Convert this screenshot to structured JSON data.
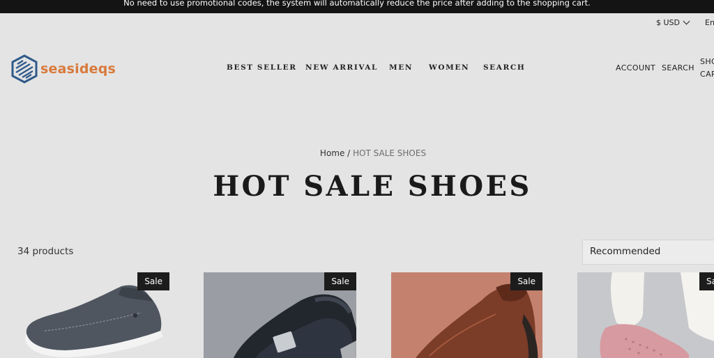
{
  "announcement": "No need to use promotional codes, the system will automatically reduce the price after adding to the shopping cart.",
  "topbar": {
    "currency": "$ USD",
    "language": "En"
  },
  "brand": {
    "name": "seasideqs",
    "accent": "#d87a3c",
    "logo_blue": "#2f5a8a"
  },
  "nav": {
    "items": [
      "BEST SELLER",
      "NEW ARRIVAL",
      "MEN",
      "WOMEN",
      "SEARCH"
    ]
  },
  "utility": {
    "account": "ACCOUNT",
    "search": "SEARCH",
    "cart_line1": "SHO",
    "cart_line2": "CAR"
  },
  "breadcrumb": {
    "home": "Home",
    "separator": " / ",
    "current": "HOT SALE SHOES"
  },
  "page": {
    "title": "HOT SALE SHOES",
    "count": "34 products"
  },
  "sort": {
    "selected": "Recommended"
  },
  "products": [
    {
      "badge": "Sale",
      "image": "grey-canvas-slip-on-shoe"
    },
    {
      "badge": "Sale",
      "image": "dark-denim-sneaker"
    },
    {
      "badge": "Sale",
      "image": "brown-leather-loafer"
    },
    {
      "badge": "Sale",
      "image": "pink-knit-shoe"
    }
  ]
}
